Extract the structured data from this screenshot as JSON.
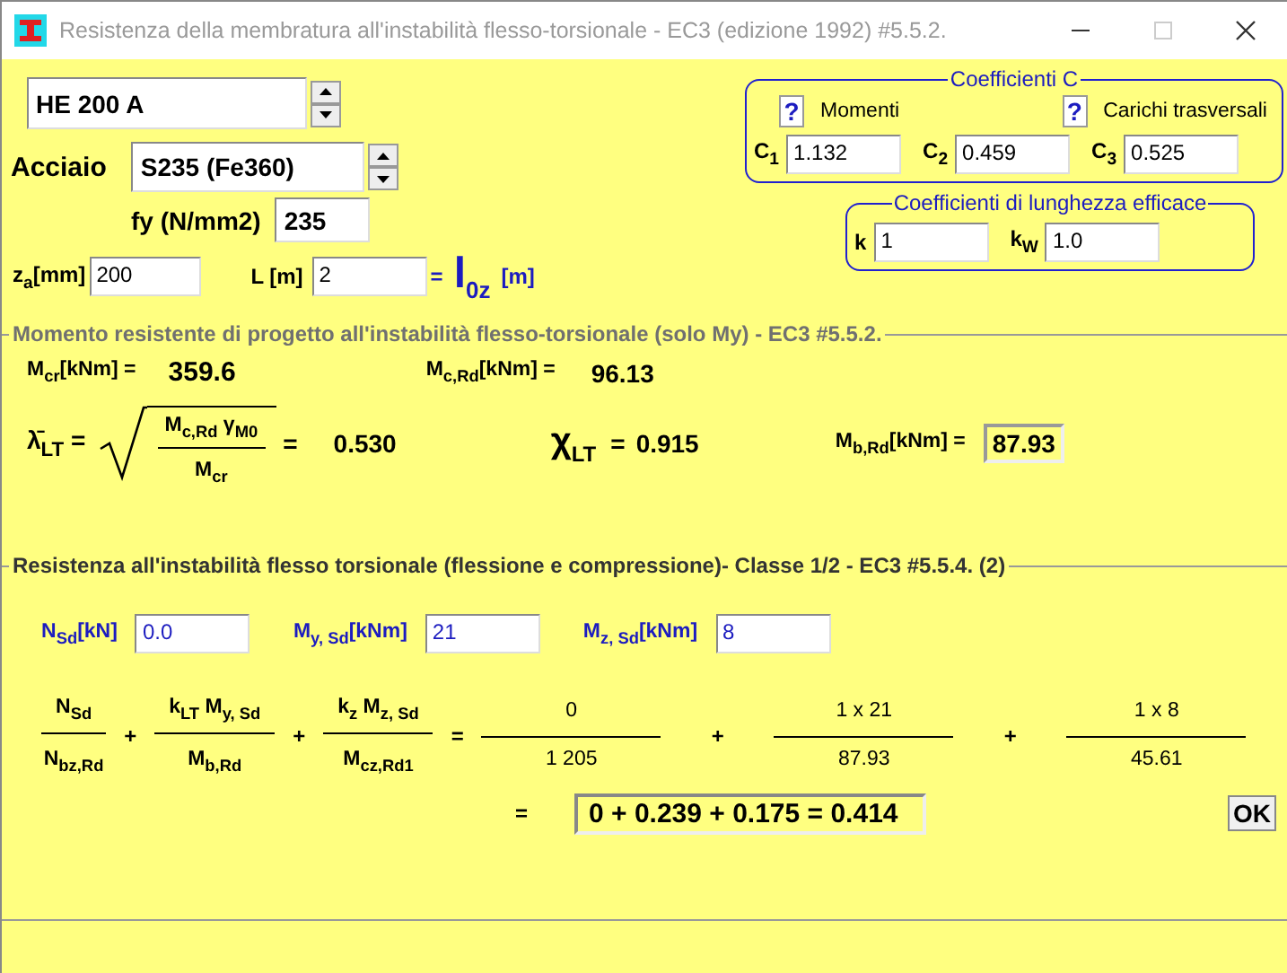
{
  "window": {
    "title": "Resistenza della membratura all'instabilità flesso-torsionale - EC3 (edizione 1992) #5.5.2.",
    "controls": [
      {
        "kind": "minimize",
        "disabled": false
      },
      {
        "kind": "maximize",
        "disabled": true
      },
      {
        "kind": "close",
        "disabled": false
      }
    ]
  },
  "profile": {
    "value": "HE 200 A"
  },
  "steel": {
    "label": "Acciaio",
    "value": "S235 (Fe360)"
  },
  "fy": {
    "label": "fy (N/mm2)",
    "value": "235"
  },
  "length_row": {
    "za_label": "z$_{a}$[mm]",
    "za_value": "200",
    "l_label": "L [m]",
    "l_value": "2",
    "equals": "=",
    "l0z_symbol": "l$_{0z}$",
    "l0z_unit": "[m]"
  },
  "c_coefficients": {
    "title": "Coefficienti C",
    "help": [
      {
        "button": "?",
        "label": "Momenti"
      },
      {
        "button": "?",
        "label": "Carichi trasversali"
      }
    ],
    "fields": [
      {
        "label": "C$_{1}$",
        "value": "1.132"
      },
      {
        "label": "C$_{2}$",
        "value": "0.459"
      },
      {
        "label": "C$_{3}$",
        "value": "0.525"
      }
    ]
  },
  "length_coefficients": {
    "title": "Coefficienti di lunghezza efficace",
    "fields": [
      {
        "label": "k",
        "value": "1"
      },
      {
        "label": "k$_{W}$",
        "value": "1.0"
      }
    ]
  },
  "lt_moment": {
    "title": "Momento resistente di progetto all'instabilità flesso-torsionale (solo My) - EC3 #5.5.2.",
    "mcr": {
      "label": "M$_{cr}$[kNm] =",
      "value": "359.6"
    },
    "mcrd": {
      "label": "M$_{c,Rd}$[kNm] =",
      "value": "96.13"
    },
    "lambda": {
      "symbol": "λ̄$_{LT}$ =",
      "numerator": "M$_{c,Rd}$  γ$_{M0}$",
      "denominator": "M$_{cr}$",
      "equals": "=",
      "value": "0.530"
    },
    "chi": {
      "symbol": "χ$_{LT}$",
      "equals": "=",
      "value": "0.915"
    },
    "mbrd": {
      "label": "M$_{b,Rd}$[kNm] =",
      "value": "87.93"
    }
  },
  "interaction": {
    "title": "Resistenza all'instabilità flesso torsionale (flessione e compressione)- Classe 1/2 - EC3 #5.5.4. (2)",
    "inputs": [
      {
        "label": "N$_{Sd}$[kN]",
        "value": "0.0"
      },
      {
        "label": "M$_{y, Sd}$[kNm]",
        "value": "21"
      },
      {
        "label": "M$_{z, Sd}$[kNm]",
        "value": "8"
      }
    ],
    "symbolic": [
      {
        "numerator": "N$_{Sd}$",
        "denominator": "N$_{bz,Rd}$"
      },
      {
        "operator": "+",
        "numerator": "k$_{LT}$ M$_{y, Sd}$",
        "denominator": "M$_{b,Rd}$"
      },
      {
        "operator": "+",
        "numerator": "k$_{z}$ M$_{z, Sd}$",
        "denominator": "M$_{cz,Rd1}$"
      }
    ],
    "equals": "=",
    "numeric": [
      {
        "numerator": "0",
        "denominator": "1 205"
      },
      {
        "operator": "+",
        "numerator": "1 x  21",
        "denominator": "87.93"
      },
      {
        "operator": "+",
        "numerator": "1 x  8",
        "denominator": "45.61"
      }
    ],
    "result_equals": "=",
    "result": "0 +  0.239 +  0.175 =  0.414",
    "ok": "OK"
  }
}
